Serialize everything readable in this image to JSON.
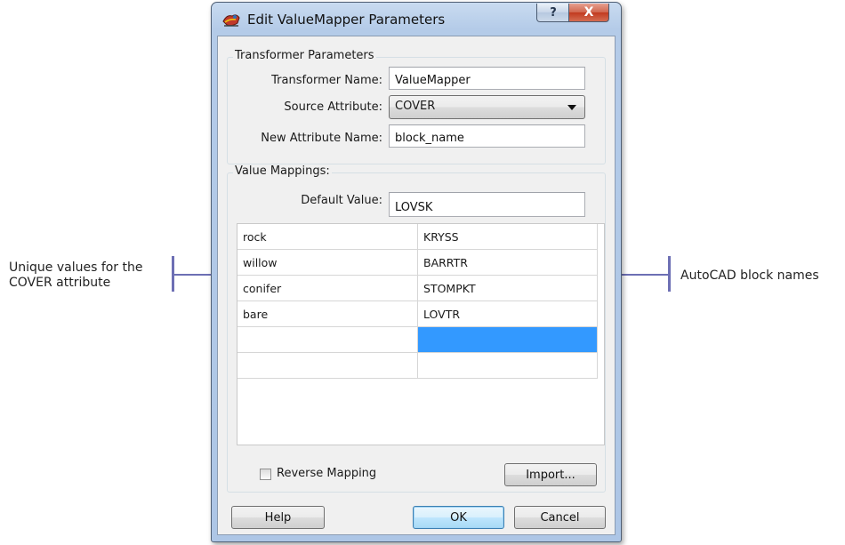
{
  "window": {
    "title": "Edit ValueMapper Parameters",
    "help_glyph": "?",
    "close_glyph": "X"
  },
  "transformer_group": {
    "legend": "Transformer Parameters",
    "name_label": "Transformer Name:",
    "name_value": "ValueMapper",
    "source_label": "Source Attribute:",
    "source_value": "COVER",
    "new_attr_label": "New Attribute Name:",
    "new_attr_value": "block_name"
  },
  "mappings_group": {
    "legend": "Value Mappings:",
    "default_label": "Default Value:",
    "default_value": "LOVSK",
    "rows": [
      {
        "source": "rock",
        "target": "KRYSS"
      },
      {
        "source": "willow",
        "target": "BARRTR"
      },
      {
        "source": "conifer",
        "target": "STOMPKT"
      },
      {
        "source": "bare",
        "target": "LOVTR"
      },
      {
        "source": "",
        "target": ""
      },
      {
        "source": "",
        "target": ""
      }
    ],
    "selected_row": 4,
    "selected_column": "target",
    "reverse_label": "Reverse Mapping",
    "reverse_checked": false,
    "import_label": "Import..."
  },
  "buttons": {
    "help": "Help",
    "ok": "OK",
    "cancel": "Cancel"
  },
  "annotations": {
    "left_line1": "Unique values for the",
    "left_line2": "COVER attribute",
    "right": "AutoCAD block names"
  },
  "colors": {
    "callout": "#6d6fb4",
    "selection": "#3399ff"
  }
}
